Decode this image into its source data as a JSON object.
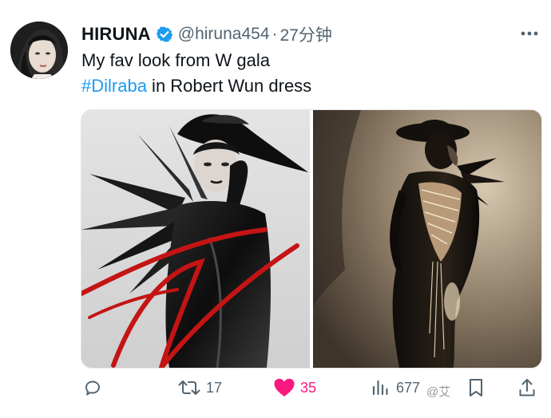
{
  "author": {
    "name": "HIRUNA",
    "handle": "@hiruna454",
    "separator": "·",
    "time": "27分钟"
  },
  "tweet": {
    "line1": "My fav look from W gala",
    "hashtag": "#Dilraba",
    "line2_rest": " in Robert Wun dress"
  },
  "actions": {
    "reply_count": "",
    "retweet_count": "17",
    "like_count": "35",
    "views_count": "677"
  },
  "watermark": {
    "text": "@艾"
  },
  "icons": {
    "verified": "verified-badge-icon",
    "more": "more-dots-icon",
    "reply": "reply-icon",
    "retweet": "retweet-icon",
    "like": "heart-filled-icon",
    "views": "views-bar-chart-icon",
    "bookmark": "bookmark-icon",
    "share": "share-icon"
  },
  "colors": {
    "accent": "#1d9bf0",
    "like": "#f91880",
    "muted": "#536471"
  }
}
